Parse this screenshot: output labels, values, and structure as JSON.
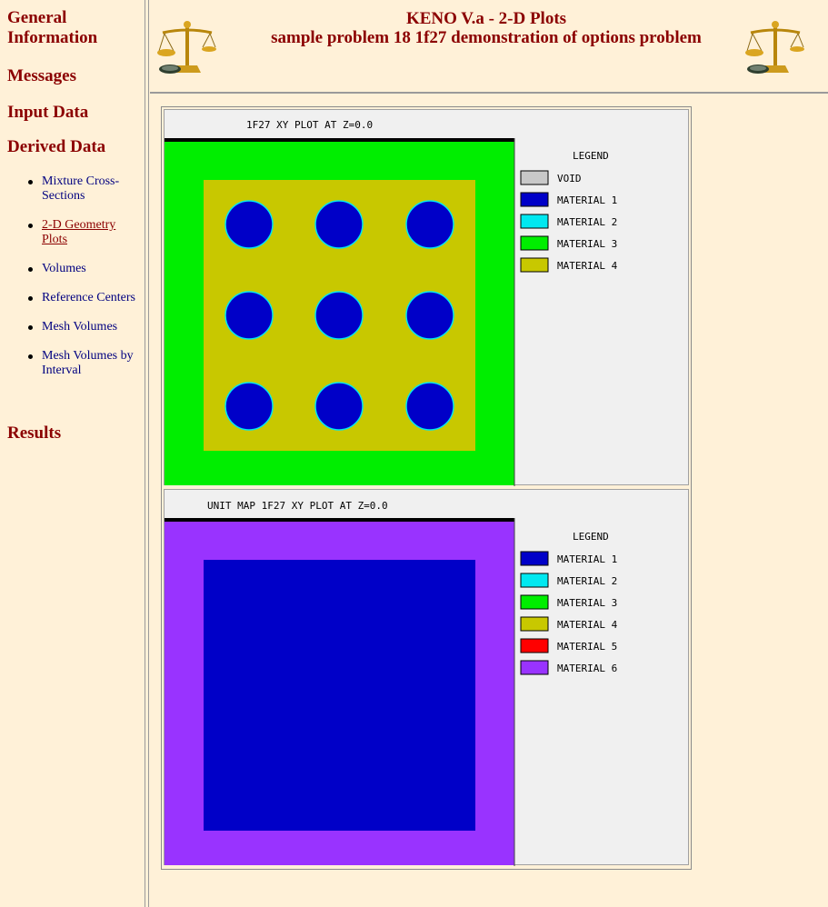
{
  "nav": {
    "general": "General Information",
    "messages": "Messages",
    "input": "Input Data",
    "derived": "Derived Data",
    "derived_items": [
      {
        "label": "Mixture Cross-Sections",
        "current": false
      },
      {
        "label": "2-D Geometry Plots",
        "current": true
      },
      {
        "label": "Volumes",
        "current": false
      },
      {
        "label": "Reference Centers",
        "current": false
      },
      {
        "label": "Mesh Volumes",
        "current": false
      },
      {
        "label": "Mesh Volumes by Interval",
        "current": false
      }
    ],
    "results": "Results"
  },
  "header": {
    "title_line1": "KENO V.a - 2-D Plots",
    "title_line2": "sample problem 18 1f27 demonstration of options problem"
  },
  "plots": [
    {
      "title": "1F27 XY PLOT AT Z=0.0",
      "legend_title": "LEGEND",
      "legend": [
        {
          "label": "VOID",
          "color": "#c8c8c8"
        },
        {
          "label": "MATERIAL 1",
          "color": "#0000c8"
        },
        {
          "label": "MATERIAL 2",
          "color": "#00e8f0"
        },
        {
          "label": "MATERIAL 3",
          "color": "#00ee00"
        },
        {
          "label": "MATERIAL 4",
          "color": "#c8c800"
        }
      ]
    },
    {
      "title": "UNIT MAP 1F27 XY PLOT AT Z=0.0",
      "legend_title": "LEGEND",
      "legend": [
        {
          "label": "MATERIAL 1",
          "color": "#0000c8"
        },
        {
          "label": "MATERIAL 2",
          "color": "#00e8f0"
        },
        {
          "label": "MATERIAL 3",
          "color": "#00ee00"
        },
        {
          "label": "MATERIAL 4",
          "color": "#c8c800"
        },
        {
          "label": "MATERIAL 5",
          "color": "#ff0000"
        },
        {
          "label": "MATERIAL 6",
          "color": "#9933ff"
        }
      ]
    }
  ]
}
